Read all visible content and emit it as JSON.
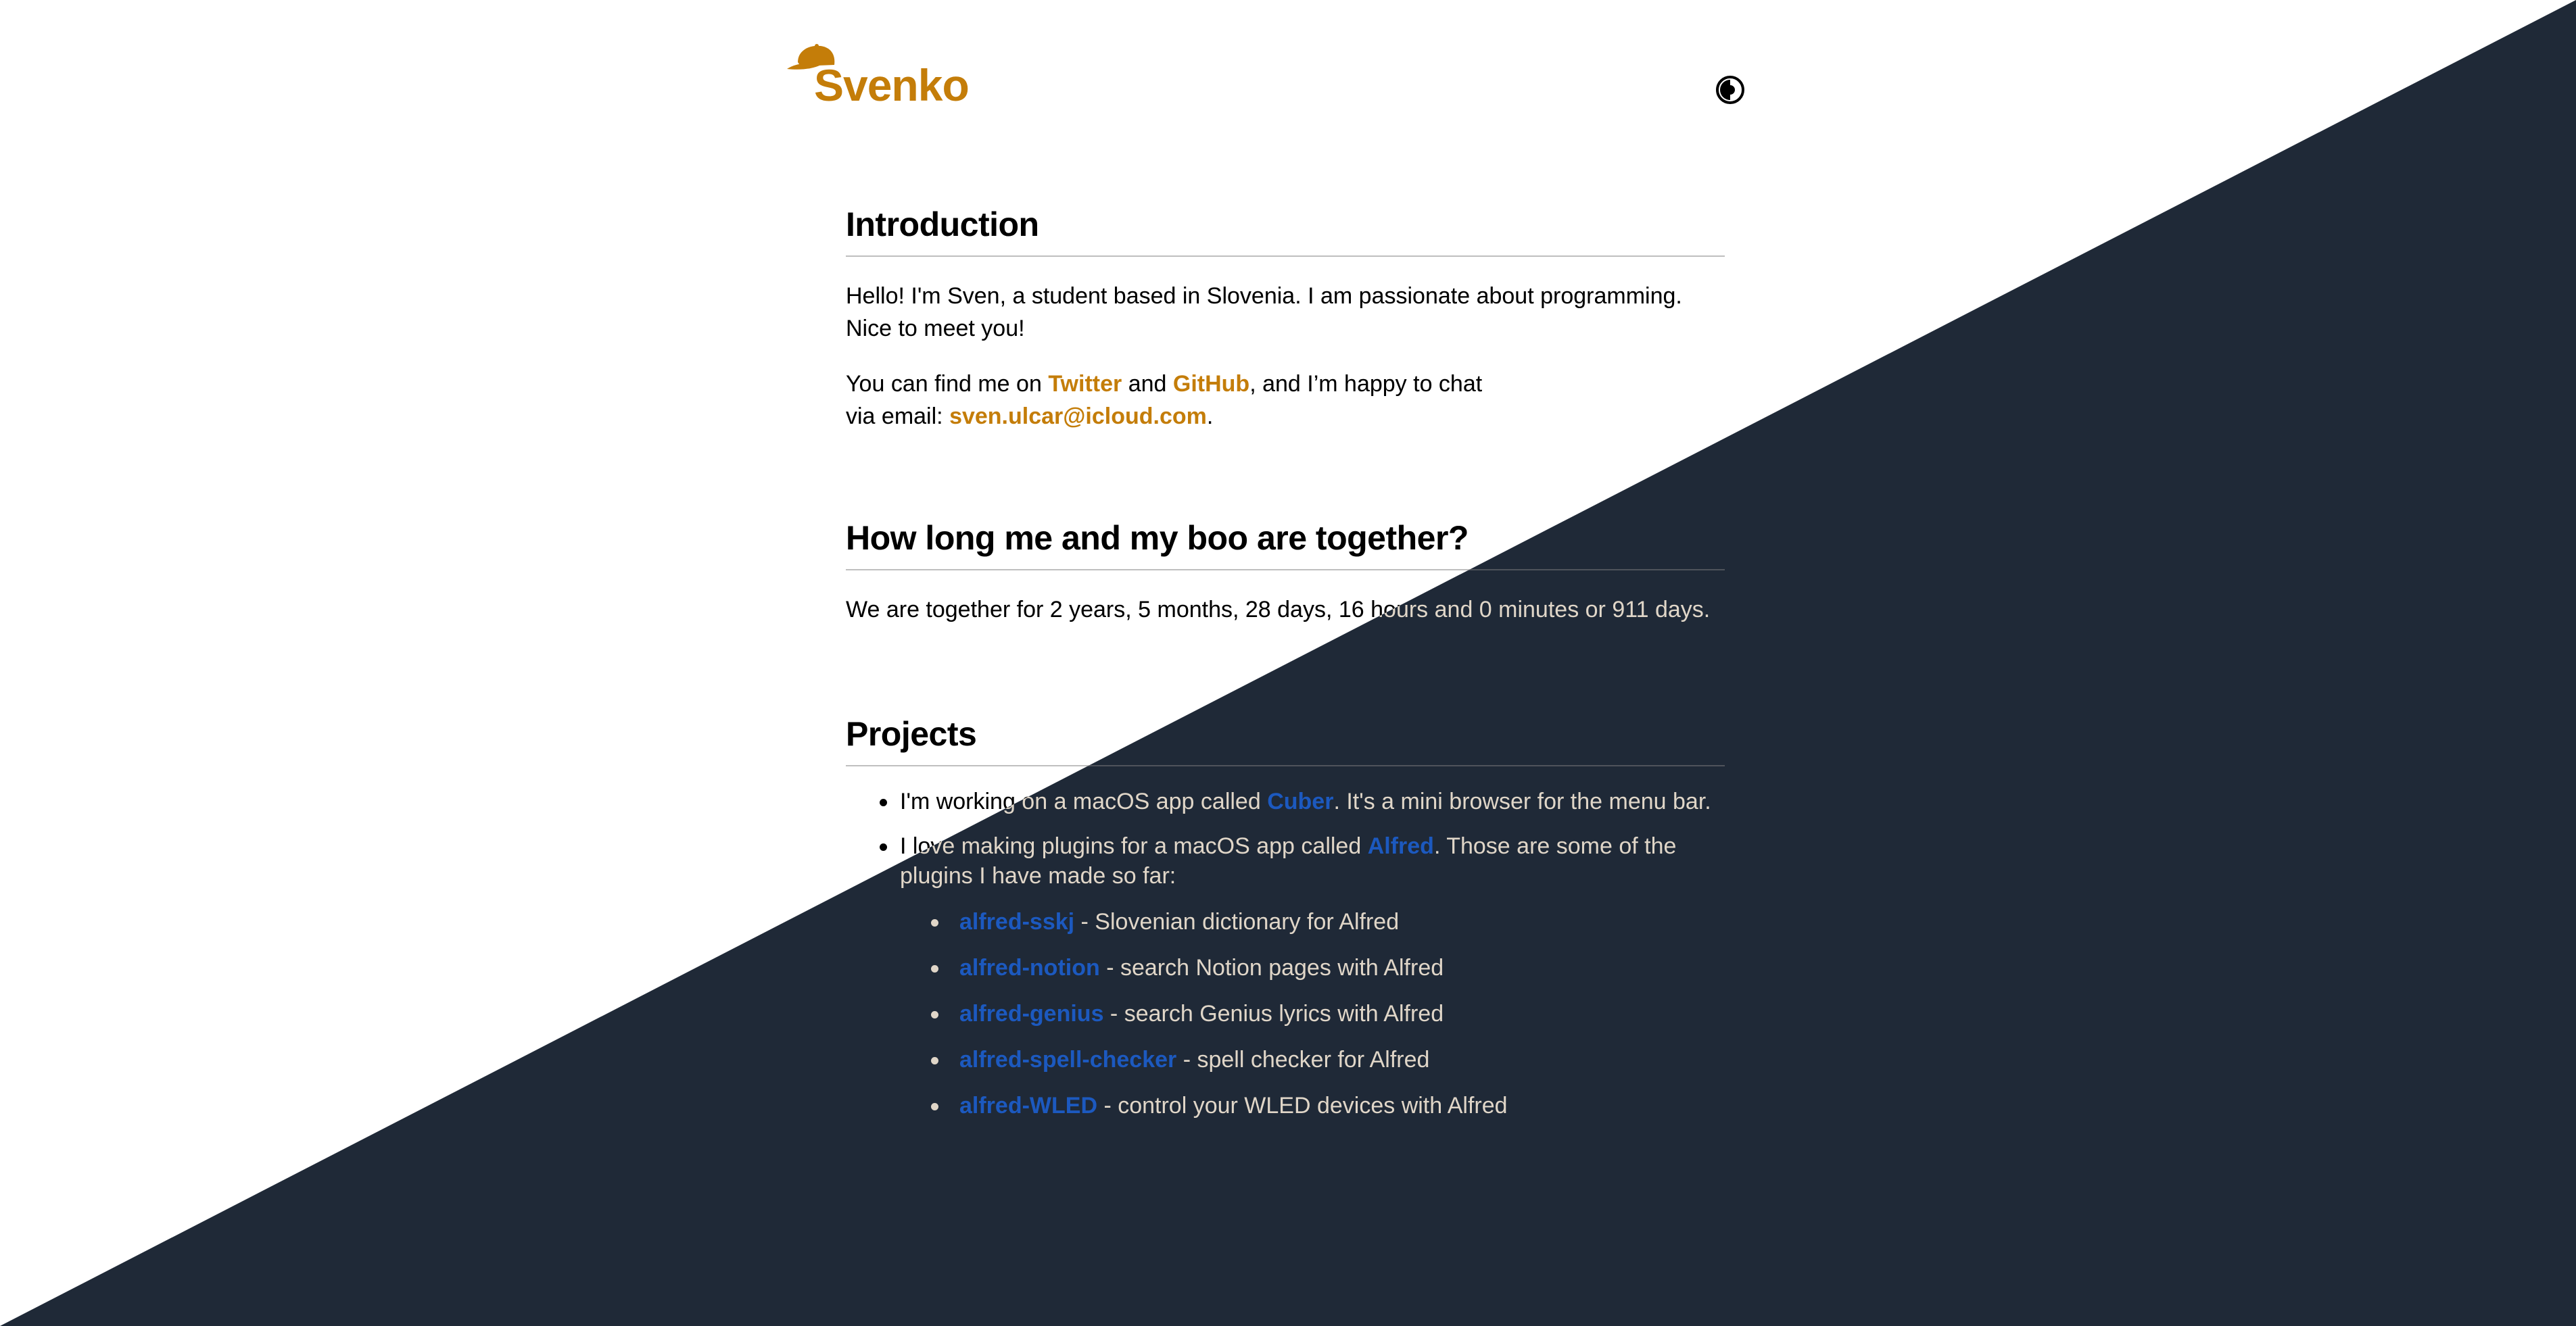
{
  "header": {
    "site_name": "Svenko",
    "logo_icon": "cap-icon",
    "theme_toggle_icon": "half-circle-contrast-icon"
  },
  "colors": {
    "background_light": "#ffffff",
    "background_dark": "#1f2937",
    "text_dark": "#1f2937",
    "accent": "#3b82f6"
  },
  "intro": {
    "heading": "Introduction",
    "p1": "Hello! I'm Sven, a student based in Slovenia. I am passionate about programming. Nice to meet you!",
    "p2_prefix": "You can find me on",
    "twitter_label": "Twitter",
    "and_text": "and",
    "github_label": "GitHub",
    "p2_mid": ", and I’m happy to chat via email:",
    "email_label": "sven.ulcar@icloud.com",
    "period": "."
  },
  "together": {
    "heading": "How long me and my boo are together?",
    "text": "We are together for 2 years, 5 months, 28 days, 16 hours and 0 minutes or 911 days."
  },
  "projects": {
    "heading": "Projects",
    "item1_prefix": "I'm working on a macOS app called",
    "item1_link": "Cuber",
    "item1_suffix": ". It's a mini browser for the menu bar.",
    "item2_prefix": "I love making plugins for a macOS app called",
    "item2_link": "Alfred",
    "item2_suffix": ". Those are some of the plugins I have made so far:",
    "plugins": [
      {
        "name": "alfred-sskj",
        "desc": " - Slovenian dictionary for Alfred"
      },
      {
        "name": "alfred-notion",
        "desc": " - search Notion pages with Alfred"
      },
      {
        "name": "alfred-genius",
        "desc": " - search Genius lyrics with Alfred"
      },
      {
        "name": "alfred-spell-checker",
        "desc": " - spell checker for Alfred"
      },
      {
        "name": "alfred-WLED",
        "desc": " - control your WLED devices with Alfred"
      }
    ]
  }
}
